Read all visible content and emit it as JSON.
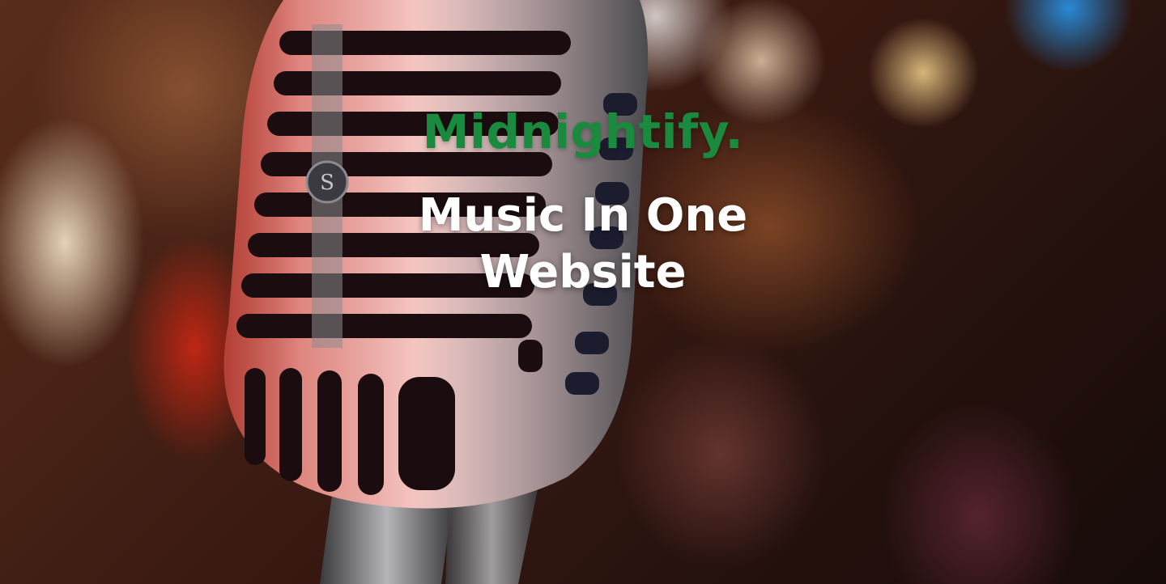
{
  "hero": {
    "brand": "Midnightify.",
    "tagline": "Music In One Website"
  },
  "colors": {
    "brand": "#1a8a3e",
    "tagline": "#ffffff"
  },
  "background": {
    "subject": "vintage-microphone"
  }
}
